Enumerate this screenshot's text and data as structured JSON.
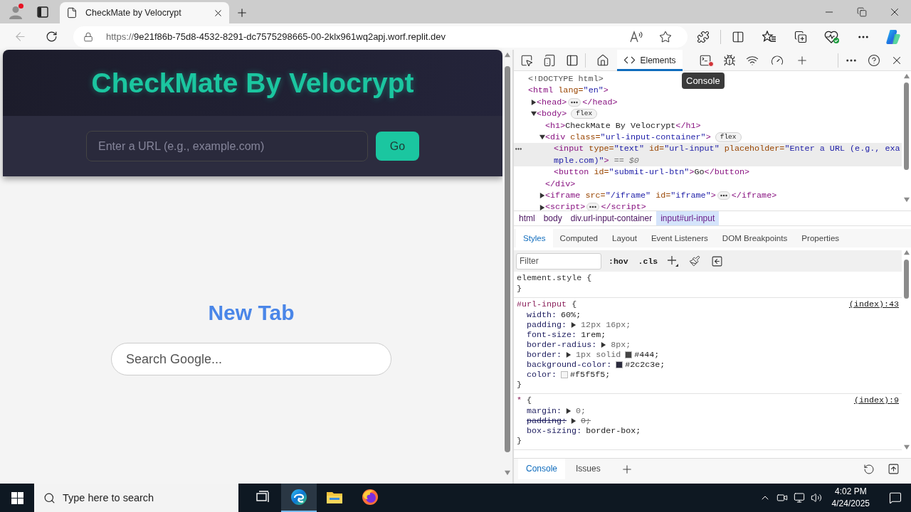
{
  "browser": {
    "profile_notification": true,
    "tabs": [
      {
        "title": "CheckMate by Velocrypt",
        "selected": true
      }
    ],
    "back_enabled": false,
    "address_bar": {
      "scheme": "https://",
      "host": "9e21f86b-75d8-4532-8291-dc7575298665-00-2klx961wq2apj.worf.replit.dev"
    }
  },
  "page": {
    "header": {
      "title": "CheckMate By Velocrypt",
      "url_input": {
        "placeholder": "Enter a URL (e.g., example.com)"
      },
      "submit_button": "Go"
    },
    "iframe": {
      "heading": "New Tab",
      "search": {
        "placeholder": "Search Google..."
      }
    }
  },
  "devtools": {
    "tabs": [
      {
        "kind": "welcome",
        "selected": false
      },
      {
        "kind": "elements",
        "label": "Elements",
        "selected": true
      },
      {
        "kind": "console",
        "selected": false,
        "errors": true
      },
      {
        "kind": "sources",
        "selected": false
      },
      {
        "kind": "network",
        "selected": false
      },
      {
        "kind": "performance",
        "selected": false
      }
    ],
    "tooltip": "Console",
    "dom_tree": [
      {
        "selected": false,
        "tokens": [
          {
            "kind": "doctype",
            "text": "<!DOCTYPE html>"
          }
        ]
      },
      {
        "selected": false,
        "tokens": [
          {
            "kind": "tag",
            "text": "<html"
          },
          {
            "kind": "attr_name",
            "text": " lang="
          },
          {
            "kind": "attr_value",
            "text": "\"en\""
          },
          {
            "kind": "tag",
            "text": ">"
          }
        ],
        "children": [
          {
            "selected": false,
            "expanded": false,
            "tokens": [
              {
                "kind": "tag",
                "text": "<head>"
              },
              {
                "kind": "collapsed"
              },
              {
                "kind": "tag",
                "text": "</head>"
              }
            ]
          },
          {
            "selected": false,
            "expanded": true,
            "badge": "flex",
            "tokens": [
              {
                "kind": "tag",
                "text": "<body>"
              }
            ],
            "children": [
              {
                "selected": false,
                "tokens": [
                  {
                    "kind": "tag",
                    "text": "<h1>"
                  },
                  {
                    "kind": "text",
                    "text": "CheckMate By Velocrypt"
                  },
                  {
                    "kind": "tag",
                    "text": "</h1>"
                  }
                ]
              },
              {
                "selected": false,
                "expanded": true,
                "badge": "flex",
                "tokens": [
                  {
                    "kind": "tag",
                    "text": "<div"
                  },
                  {
                    "kind": "attr_name",
                    "text": " class="
                  },
                  {
                    "kind": "attr_value",
                    "text": "\"url-input-container\""
                  },
                  {
                    "kind": "tag",
                    "text": ">"
                  }
                ],
                "children": [
                  {
                    "selected": true,
                    "tokens": [
                      {
                        "kind": "tag",
                        "text": "<input"
                      },
                      {
                        "kind": "attr_name",
                        "text": " type="
                      },
                      {
                        "kind": "attr_value",
                        "text": "\"text\""
                      },
                      {
                        "kind": "attr_name",
                        "text": " id="
                      },
                      {
                        "kind": "attr_value",
                        "text": "\"url-input\""
                      },
                      {
                        "kind": "attr_name",
                        "text": " placeholder="
                      },
                      {
                        "kind": "attr_value",
                        "text": "\"Enter a URL (e.g., example.com)\""
                      },
                      {
                        "kind": "tag",
                        "text": ">"
                      },
                      {
                        "kind": "console_ref",
                        "text": " == "
                      },
                      {
                        "kind": "console_var",
                        "text": "$0"
                      }
                    ]
                  },
                  {
                    "selected": false,
                    "tokens": [
                      {
                        "kind": "tag",
                        "text": "<button"
                      },
                      {
                        "kind": "attr_name",
                        "text": " id="
                      },
                      {
                        "kind": "attr_value",
                        "text": "\"submit-url-btn\""
                      },
                      {
                        "kind": "tag",
                        "text": ">"
                      },
                      {
                        "kind": "text",
                        "text": "Go"
                      },
                      {
                        "kind": "tag",
                        "text": "</button>"
                      }
                    ]
                  }
                ],
                "closing_tokens": [
                  {
                    "kind": "tag",
                    "text": "</div>"
                  }
                ]
              },
              {
                "selected": false,
                "expanded": false,
                "tokens": [
                  {
                    "kind": "tag",
                    "text": "<iframe"
                  },
                  {
                    "kind": "attr_name",
                    "text": " src="
                  },
                  {
                    "kind": "attr_value",
                    "text": "\"/iframe\""
                  },
                  {
                    "kind": "attr_name",
                    "text": " id="
                  },
                  {
                    "kind": "attr_value",
                    "text": "\"iframe\""
                  },
                  {
                    "kind": "tag",
                    "text": ">"
                  },
                  {
                    "kind": "collapsed"
                  },
                  {
                    "kind": "tag",
                    "text": "</iframe>"
                  }
                ]
              },
              {
                "selected": false,
                "expanded": false,
                "tokens": [
                  {
                    "kind": "tag",
                    "text": "<script>"
                  },
                  {
                    "kind": "collapsed"
                  },
                  {
                    "kind": "tag",
                    "text": "</script>"
                  }
                ]
              }
            ]
          }
        ]
      }
    ],
    "breadcrumbs": [
      {
        "label": "html",
        "selected": false
      },
      {
        "label": "body",
        "selected": false
      },
      {
        "label": "div.url-input-container",
        "selected": false
      },
      {
        "label": "input#url-input",
        "selected": true
      }
    ],
    "panel_tabs": [
      {
        "label": "Styles",
        "selected": true
      },
      {
        "label": "Computed",
        "selected": false
      },
      {
        "label": "Layout",
        "selected": false
      },
      {
        "label": "Event Listeners",
        "selected": false
      },
      {
        "label": "DOM Breakpoints",
        "selected": false
      },
      {
        "label": "Properties",
        "selected": false
      }
    ],
    "filter": {
      "placeholder": "Filter"
    },
    "filter_toggles": [
      ":hov",
      ".cls"
    ],
    "rules": [
      {
        "kind": "inline",
        "selector": "element.style",
        "brace_open": "{",
        "brace_close": "}"
      },
      {
        "kind": "author",
        "selector": "#url-input",
        "brace_open": "{",
        "brace_close": "}",
        "source": "(index):43",
        "properties": [
          {
            "name": "width:",
            "value": "60%;",
            "expandable": false,
            "overridden": false
          },
          {
            "name": "padding:",
            "value": "12px 16px;",
            "expandable": true,
            "overridden": false
          },
          {
            "name": "font-size:",
            "value": "1rem;",
            "expandable": false,
            "overridden": false
          },
          {
            "name": "border-radius:",
            "value": "8px;",
            "expandable": true,
            "overridden": false
          },
          {
            "name": "border:",
            "value": "1px solid",
            "expandable": true,
            "overridden": false,
            "color": "#444444",
            "color_text": "#444;"
          },
          {
            "name": "background-color:",
            "expandable": false,
            "overridden": false,
            "color": "#2c2c3e",
            "color_text": "#2c2c3e;"
          },
          {
            "name": "color:",
            "expandable": false,
            "overridden": false,
            "color": "#f5f5f5",
            "color_text": "#f5f5f5;"
          }
        ]
      },
      {
        "kind": "author",
        "selector": "*",
        "brace_open": "{",
        "brace_close": "}",
        "source": "(index):9",
        "properties": [
          {
            "name": "margin:",
            "value": "0;",
            "expandable": true,
            "overridden": false
          },
          {
            "name": "padding:",
            "value": "0;",
            "expandable": true,
            "overridden": true
          },
          {
            "name": "box-sizing:",
            "value": "border-box;",
            "expandable": false,
            "overridden": false
          }
        ]
      }
    ],
    "drawer_tabs": [
      {
        "label": "Console",
        "selected": true
      },
      {
        "label": "Issues",
        "selected": false
      }
    ]
  },
  "taskbar": {
    "search": {
      "placeholder": "Type here to search"
    },
    "apps": [
      {
        "kind": "task_view",
        "active": false
      },
      {
        "kind": "edge",
        "active": true
      },
      {
        "kind": "explorer",
        "active": false
      },
      {
        "kind": "firefox",
        "active": false
      }
    ],
    "clock": {
      "time": "4:02 PM",
      "date": "4/24/2025"
    }
  }
}
